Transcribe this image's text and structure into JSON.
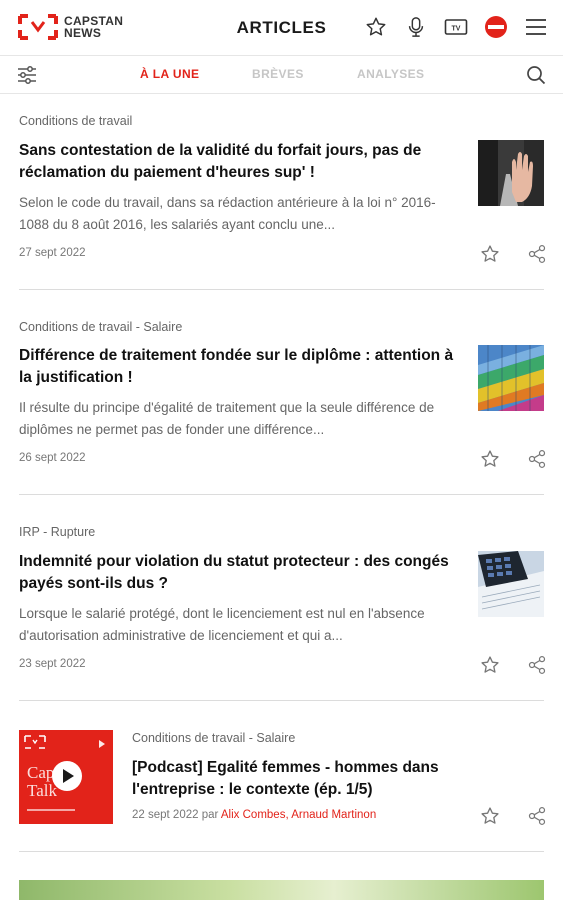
{
  "header": {
    "logo_line1": "CAPSTAN",
    "logo_line2": "NEWS",
    "title": "ARTICLES",
    "icons": [
      "star-icon",
      "microphone-icon",
      "tv-icon",
      "news-badge-icon",
      "menu-icon"
    ]
  },
  "tabs": [
    {
      "label": "À LA UNE",
      "active": true
    },
    {
      "label": "BRÈVES",
      "active": false
    },
    {
      "label": "ANALYSES",
      "active": false
    }
  ],
  "colors": {
    "accent": "#e2231a",
    "muted": "#c6c6c6"
  },
  "articles": [
    {
      "category": "Conditions de travail",
      "title": "Sans contestation de la validité du forfait jours, pas de réclamation du paiement d'heures sup' !",
      "excerpt": "Selon le code du travail, dans sa rédaction antérieure à la loi n° 2016-1088 du 8 août 2016, les salariés ayant conclu une...",
      "date": "27 sept 2022"
    },
    {
      "category": "Conditions de travail - Salaire",
      "title": "Différence de traitement fondée sur le diplôme : attention à la justification !",
      "excerpt": "Il résulte du principe d'égalité de traitement que la seule différence de diplômes ne permet pas de fonder une différence...",
      "date": "26 sept 2022"
    },
    {
      "category": "IRP - Rupture",
      "title": "Indemnité pour violation du statut protecteur : des congés payés sont-ils dus ?",
      "excerpt": "Lorsque le salarié protégé, dont le licenciement est nul en l'absence d'autorisation administrative de licenciement et qui a...",
      "date": "23 sept 2022"
    }
  ],
  "podcast": {
    "category": "Conditions de travail - Salaire",
    "title": "[Podcast] Egalité femmes - hommes dans l'entreprise : le contexte (ép. 1/5)",
    "date_prefix": "22 sept 2022 par",
    "authors": "Alix Combes, Arnaud Martinon",
    "thumb_text1": "Capstan",
    "thumb_text2": "Talk"
  }
}
